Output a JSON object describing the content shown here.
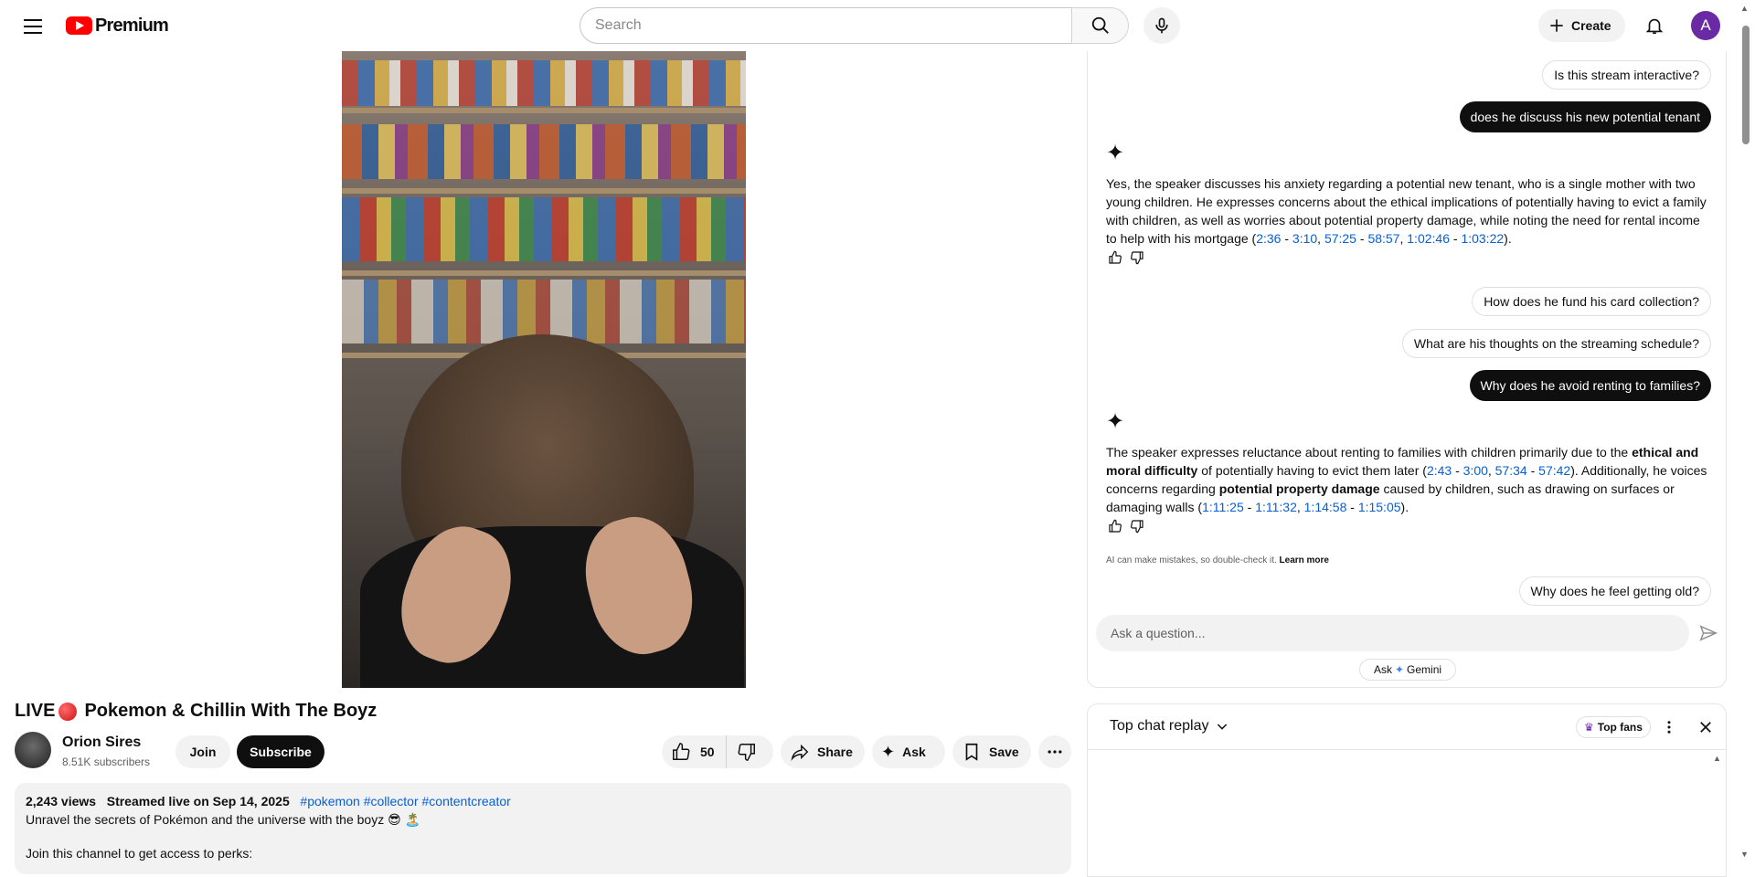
{
  "header": {
    "logo_text": "Premium",
    "search_placeholder": "Search",
    "create_label": "Create",
    "avatar_letter": "A"
  },
  "video": {
    "title": "Pokemon & Chillin With The Boyz",
    "live_prefix": "LIVE"
  },
  "channel": {
    "name": "Orion Sires",
    "subscribers": "8.51K subscribers",
    "join_label": "Join",
    "subscribe_label": "Subscribe"
  },
  "actions": {
    "like_count": "50",
    "share_label": "Share",
    "ask_label": "Ask",
    "save_label": "Save"
  },
  "description": {
    "views": "2,243 views",
    "streamed": "Streamed live on Sep 14, 2025",
    "tags": [
      "#pokemon",
      "#collector",
      "#contentcreator"
    ],
    "line1": "Unravel the secrets of Pokémon and the universe with the boyz 😎 🏝️",
    "line2": "Join this channel to get access to perks:"
  },
  "ai_chat": {
    "chip1": "Is this stream interactive?",
    "user_q1": "does he discuss his new potential tenant",
    "answer1": {
      "text1": "Yes, the speaker discusses his anxiety regarding a potential new tenant, who is a single mother with two young children. He expresses concerns about the ethical implications of potentially having to evict a family with children, as well as worries about potential property damage, while noting the need for rental income to help with his mortgage (",
      "ts": [
        "2:36",
        "3:10",
        "57:25",
        "58:57",
        "1:02:46",
        "1:03:22"
      ],
      "end": ")."
    },
    "chip2": "How does he fund his card collection?",
    "chip3": "What are his thoughts on the streaming schedule?",
    "user_q2": "Why does he avoid renting to families?",
    "answer2": {
      "text1": "The speaker expresses reluctance about renting to families with children primarily due to the ",
      "bold1": "ethical and moral difficulty",
      "text2": " of potentially having to evict them later (",
      "ts1": [
        "2:43",
        "3:00",
        "57:34",
        "57:42"
      ],
      "text3": "). Additionally, he voices concerns regarding ",
      "bold2": "potential property damage",
      "text4": " caused by children, such as drawing on surfaces or damaging walls (",
      "ts2": [
        "1:11:25",
        "1:11:32",
        "1:14:58",
        "1:15:05"
      ],
      "end": ")."
    },
    "disclaimer": "AI can make mistakes, so double-check it.",
    "learn_more": "Learn more",
    "chip4": "Why does he feel getting old?",
    "input_placeholder": "Ask a question...",
    "ask_gemini_ask": "Ask",
    "ask_gemini_name": "Gemini"
  },
  "live_chat": {
    "title": "Top chat replay",
    "top_fans": "Top fans"
  },
  "colors": {
    "brand_red": "#ff0000",
    "link_blue": "#065fd4",
    "avatar_purple": "#6a2aa3"
  }
}
